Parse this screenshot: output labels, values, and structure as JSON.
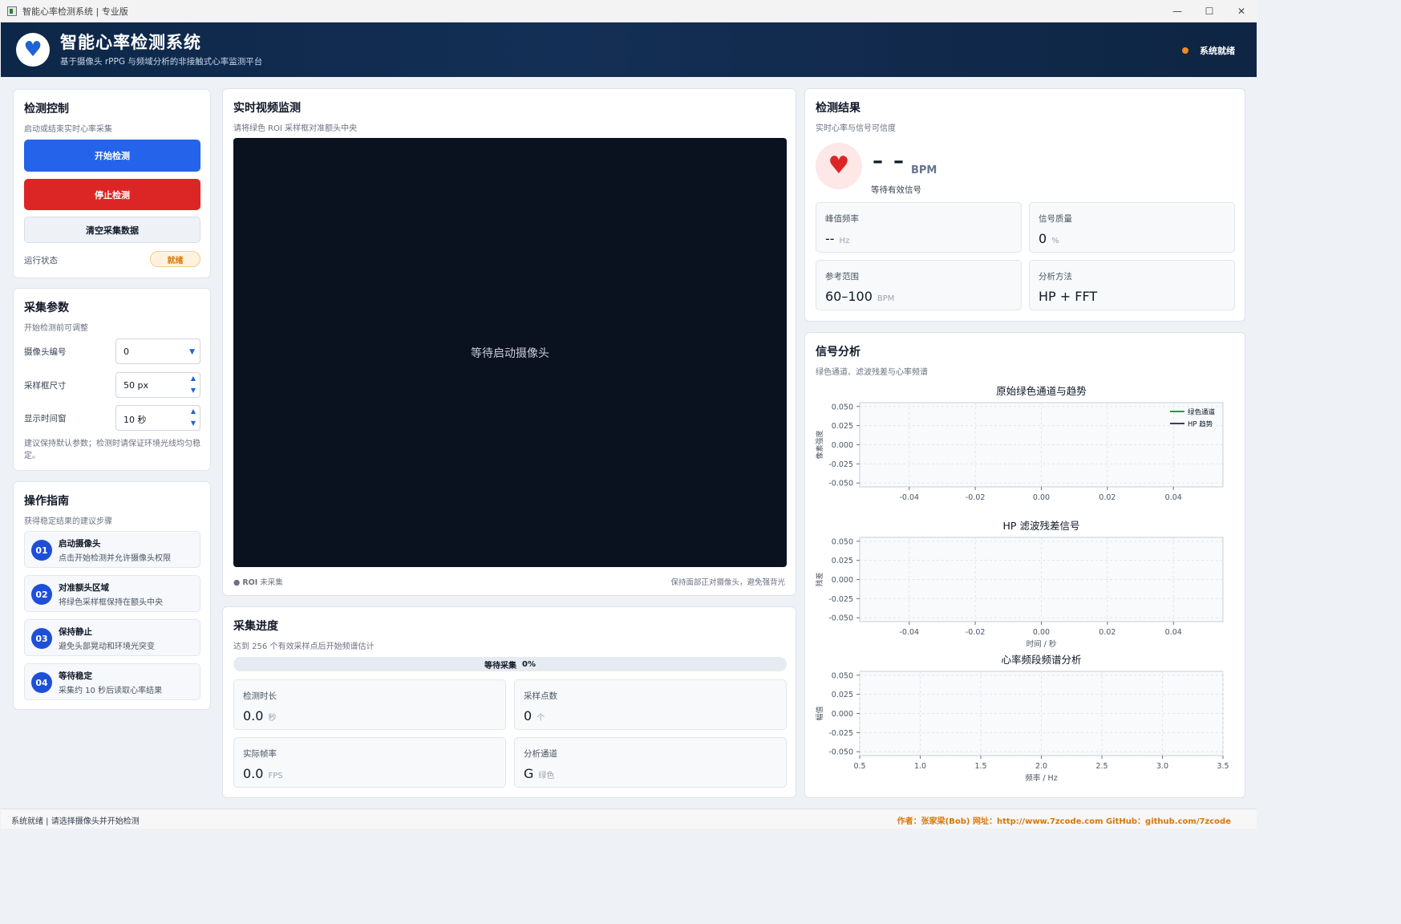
{
  "window": {
    "title": "智能心率检测系统 | 专业版",
    "controls": {
      "minimize": "—",
      "maximize": "☐",
      "close": "✕"
    }
  },
  "header": {
    "title": "智能心率检测系统",
    "subtitle": "基于摄像头 rPPG 与频域分析的非接触式心率监测平台",
    "status": "系统就绪",
    "logo_icon": "heart-icon",
    "status_color": "#f08a1c"
  },
  "control": {
    "title": "检测控制",
    "subtitle": "启动或结束实时心率采集",
    "start_label": "开始检测",
    "stop_label": "停止检测",
    "clear_label": "清空采集数据",
    "run_state_label": "运行状态",
    "run_state_value": "就绪"
  },
  "params": {
    "title": "采集参数",
    "subtitle": "开始检测前可调整",
    "camera_label": "摄像头编号",
    "camera_value": "0",
    "roi_label": "采样框尺寸",
    "roi_value": "50 px",
    "window_label": "显示时间窗",
    "window_value": "10 秒",
    "tip": "建议保持默认参数；检测时请保证环境光线均匀稳定。"
  },
  "guide": {
    "title": "操作指南",
    "subtitle": "获得稳定结果的建议步骤",
    "steps": [
      {
        "num": "01",
        "title": "启动摄像头",
        "desc": "点击开始检测并允许摄像头权限"
      },
      {
        "num": "02",
        "title": "对准额头区域",
        "desc": "将绿色采样框保持在额头中央"
      },
      {
        "num": "03",
        "title": "保持静止",
        "desc": "避免头部晃动和环境光突变"
      },
      {
        "num": "04",
        "title": "等待稳定",
        "desc": "采集约 10 秒后读取心率结果"
      }
    ]
  },
  "video": {
    "title": "实时视频监测",
    "subtitle": "请将绿色 ROI 采样框对准额头中央",
    "placeholder": "等待启动摄像头",
    "roi_status_dot": "●",
    "roi_status_tag": "ROI",
    "roi_status": "未采集",
    "tip": "保持面部正对摄像头，避免强背光"
  },
  "progress": {
    "title": "采集进度",
    "subtitle": "达到 256 个有效采样点后开始频谱估计",
    "label": "等待采集",
    "percent": "0%",
    "fraction": 0,
    "metrics": [
      {
        "label": "检测时长",
        "value": "0.0",
        "unit": "秒"
      },
      {
        "label": "采样点数",
        "value": "0",
        "unit": "个"
      },
      {
        "label": "实际帧率",
        "value": "0.0",
        "unit": "FPS"
      },
      {
        "label": "分析通道",
        "value": "G",
        "unit": "绿色"
      }
    ]
  },
  "result": {
    "title": "检测结果",
    "subtitle": "实时心率与信号可信度",
    "bpm_value": "– –",
    "bpm_unit": "BPM",
    "note": "等待有效信号",
    "metrics": [
      {
        "label": "峰值频率",
        "value": "--",
        "unit": "Hz"
      },
      {
        "label": "信号质量",
        "value": "0",
        "unit": "%"
      },
      {
        "label": "参考范围",
        "value": "60–100",
        "unit": "BPM"
      },
      {
        "label": "分析方法",
        "value": "HP + FFT",
        "unit": ""
      }
    ]
  },
  "analysis": {
    "title": "信号分析",
    "subtitle": "绿色通道、滤波残差与心率频谱"
  },
  "chart_data": [
    {
      "type": "line",
      "title": "原始绿色通道与趋势",
      "xlabel": "",
      "ylabel": "像素强度",
      "xlim": [
        -0.055,
        0.055
      ],
      "ylim": [
        -0.055,
        0.055
      ],
      "xticks": [
        "-0.04",
        "-0.02",
        "0.00",
        "0.02",
        "0.04"
      ],
      "yticks": [
        "0.050",
        "0.025",
        "0.000",
        "-0.025",
        "-0.050"
      ],
      "grid": true,
      "legend": "top-right",
      "series": [
        {
          "name": "绿色通道",
          "color": "#16a34a",
          "values": []
        },
        {
          "name": "HP 趋势",
          "color": "#374151",
          "values": []
        }
      ]
    },
    {
      "type": "line",
      "title": "HP 滤波残差信号",
      "xlabel": "时间 / 秒",
      "ylabel": "残差",
      "xlim": [
        -0.055,
        0.055
      ],
      "ylim": [
        -0.055,
        0.055
      ],
      "xticks": [
        "-0.04",
        "-0.02",
        "0.00",
        "0.02",
        "0.04"
      ],
      "yticks": [
        "0.050",
        "0.025",
        "0.000",
        "-0.025",
        "-0.050"
      ],
      "grid": true,
      "series": []
    },
    {
      "type": "line",
      "title": "心率频段频谱分析",
      "xlabel": "频率 / Hz",
      "ylabel": "幅值",
      "xlim": [
        0.5,
        3.5
      ],
      "ylim": [
        -0.055,
        0.055
      ],
      "xticks": [
        "0.5",
        "1.0",
        "1.5",
        "2.0",
        "2.5",
        "3.0",
        "3.5"
      ],
      "yticks": [
        "0.050",
        "0.025",
        "0.000",
        "-0.025",
        "-0.050"
      ],
      "grid": true,
      "series": []
    }
  ],
  "statusbar": {
    "left": "系统就绪 | 请选择摄像头并开始检测",
    "right": "作者：张家梁(Bob)  网址：http://www.7zcode.com  GitHub：github.com/7zcode"
  }
}
